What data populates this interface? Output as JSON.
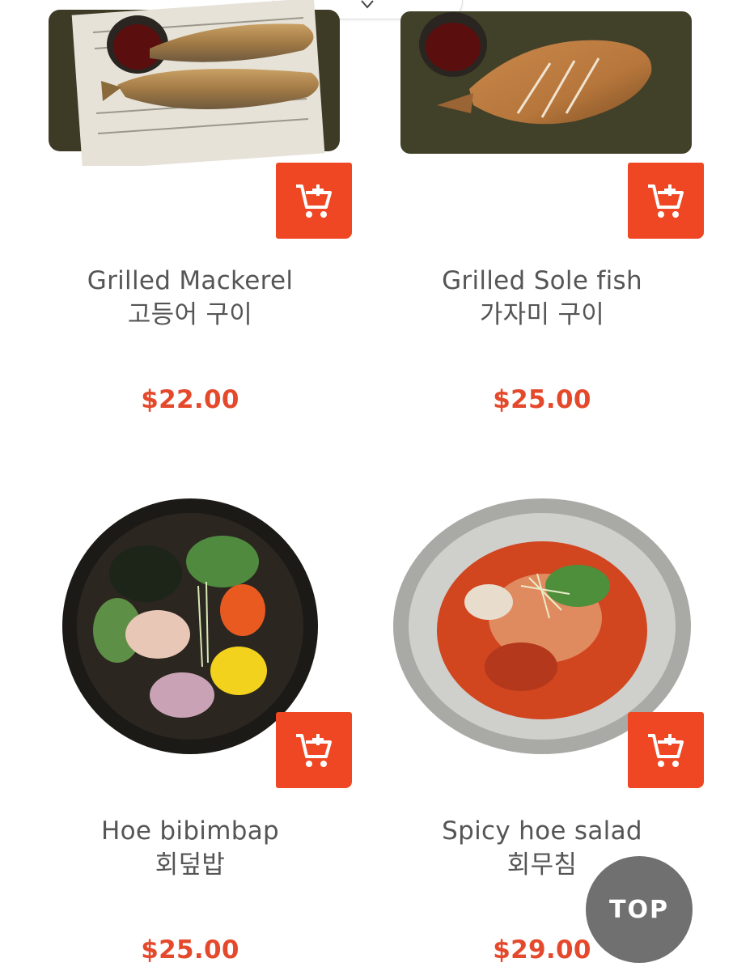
{
  "menu": {
    "items": [
      {
        "name_en": "Grilled Mackerel",
        "name_ko": "고등어 구이",
        "price": "$22.00"
      },
      {
        "name_en": "Grilled Sole fish",
        "name_ko": "가자미 구이",
        "price": "$25.00"
      },
      {
        "name_en": "Hoe bibimbap",
        "name_ko": "회덮밥",
        "price": "$25.00"
      },
      {
        "name_en": "Spicy hoe salad",
        "name_ko": "회무침",
        "price": "$29.00"
      }
    ]
  },
  "top_button": {
    "label": "TOP"
  },
  "colors": {
    "accent": "#ef4723",
    "price": "#e5492b",
    "text": "#555555",
    "top_button": "#707070"
  },
  "icons": {
    "cart": "cart-add-icon",
    "chevron": "chevron-down-icon"
  }
}
